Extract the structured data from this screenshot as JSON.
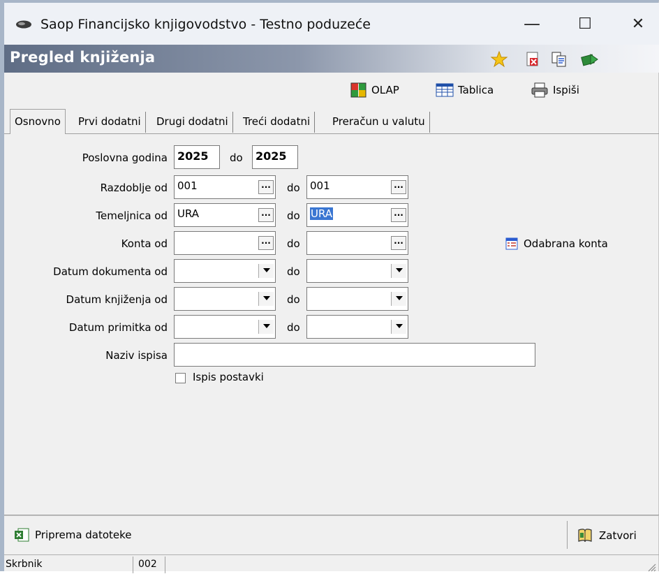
{
  "window": {
    "app_title": "Saop Financijsko knjigovodstvo - Testno poduzeće",
    "minimize_glyph": "—",
    "maximize_glyph": "☐",
    "close_glyph": "✕"
  },
  "header": {
    "title": "Pregled knjiženja",
    "icons": [
      "star-icon",
      "delete-document-icon",
      "copy-documents-icon",
      "books-arrow-icon"
    ]
  },
  "toolbar": {
    "olap_label": "OLAP",
    "tablica_label": "Tablica",
    "ispisi_label": "Ispiši"
  },
  "tabs": [
    {
      "label": "Osnovno",
      "active": true
    },
    {
      "label": "Prvi dodatni",
      "active": false
    },
    {
      "label": "Drugi dodatni",
      "active": false
    },
    {
      "label": "Treći dodatni",
      "active": false
    },
    {
      "label": "Preračun u valutu",
      "active": false
    }
  ],
  "form": {
    "do_label": "do",
    "poslovna_godina": {
      "label": "Poslovna godina",
      "from": "2025",
      "to": "2025"
    },
    "razdoblje": {
      "label": "Razdoblje od",
      "from": "001",
      "to": "001"
    },
    "temeljnica": {
      "label": "Temeljnica od",
      "from": "URA",
      "to": "URA"
    },
    "konta": {
      "label": "Konta od",
      "from": "",
      "to": ""
    },
    "datum_dokumenta": {
      "label": "Datum dokumenta od",
      "from": "",
      "to": ""
    },
    "datum_knjizenja": {
      "label": "Datum knjiženja od",
      "from": "",
      "to": ""
    },
    "datum_primitka": {
      "label": "Datum primitka od",
      "from": "",
      "to": ""
    },
    "naziv_ispisa": {
      "label": "Naziv ispisa",
      "value": ""
    },
    "ispis_postavki": {
      "label": "Ispis postavki",
      "checked": false
    },
    "ellipsis": "...",
    "odabrana_konta_label": "Odabrana konta"
  },
  "bottom": {
    "priprema_label": "Priprema datoteke",
    "zatvori_label": "Zatvori"
  },
  "status": {
    "user": "Skrbnik",
    "code": "002"
  }
}
